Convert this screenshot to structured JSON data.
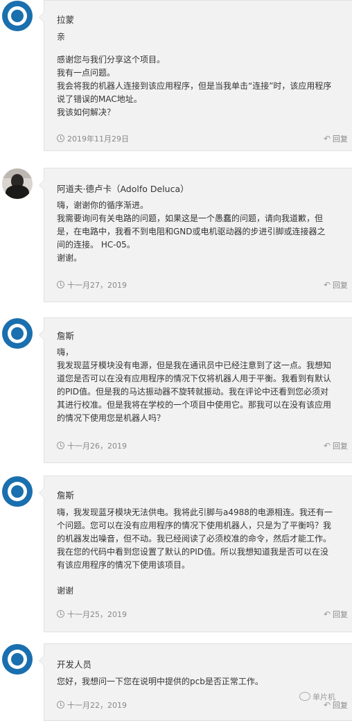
{
  "reply_label": "回复",
  "comments": [
    {
      "author": "拉蒙",
      "avatar": "wordpress-logo",
      "paragraphs": [
        [
          "亲"
        ],
        [
          "感谢您与我们分享这个项目。",
          "我有一点问题。",
          "我会将我的机器人连接到该应用程序，但是当我单击“连接”时，该应用程序",
          "说了错误的MAC地址。",
          "我该如何解决？"
        ]
      ],
      "date": "2019年11月29日"
    },
    {
      "author": "阿道夫·德卢卡（Adolfo Deluca）",
      "avatar": "user-photo",
      "paragraphs": [
        [
          "嗨，谢谢你的循序渐进。",
          "我需要询问有关电路的问题，如果这是一个愚蠢的问题，请向我道歉，但",
          "是，在电路中，我看不到电阻和GND或电机驱动器的步进引脚或连接器之",
          "间的连接。 HC-05。",
          "谢谢。"
        ]
      ],
      "date": "十一月27，2019"
    },
    {
      "author": "詹斯",
      "avatar": "wordpress-logo",
      "paragraphs": [
        [
          "嗨，",
          "我发现蓝牙模块没有电源，但是我在通讯员中已经注意到了这一点。我想知",
          "道您是否可以在没有应用程序的情况下仅将机器人用于平衡。我看到有默认",
          "的PID值。但是我的马达振动器不旋转就振动。我在评论中还看到您必须对",
          "其进行校准。但是我将在学校的一个项目中使用它。那我可以在没有该应用",
          "的情况下使用您是机器人吗？"
        ]
      ],
      "date": "十一月26，2019"
    },
    {
      "author": "詹斯",
      "avatar": "wordpress-logo",
      "paragraphs": [
        [
          "嗨，我发现蓝牙模块无法供电。我将此引脚与a4988的电源相连。我还有一",
          "个问题。您可以在没有应用程序的情况下使用机器人，只是为了平衡吗？我",
          "的机器发出噪音，但不动。我已经阅读了必须校准的命令，然后才能工作。",
          "我在您的代码中看到您设置了默认的PID值。所以我想知道我是否可以在没",
          "有该应用程序的情况下使用该项目。"
        ],
        [
          "谢谢"
        ]
      ],
      "date": "十一月25，2019"
    },
    {
      "author": "开发人员",
      "avatar": "wordpress-logo",
      "paragraphs": [
        [
          "您好，我想问一下您在说明中提供的pcb是否正常工作。"
        ]
      ],
      "date": "十一月22，2019"
    }
  ],
  "watermark": "单片机"
}
